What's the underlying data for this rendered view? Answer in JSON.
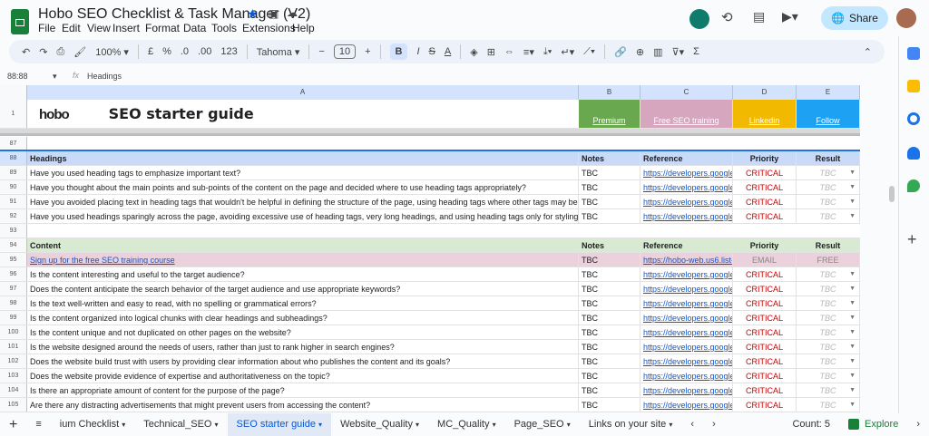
{
  "app": {
    "title": "Hobo SEO Checklist & Task Manager (V2)",
    "menu": [
      "File",
      "Edit",
      "View",
      "Insert",
      "Format",
      "Data",
      "Tools",
      "Extensions",
      "Help"
    ],
    "share_label": "Share"
  },
  "toolbar": {
    "zoom": "100%",
    "currency": "£",
    "percent": "%",
    "dec_less": ".0",
    "dec_more": ".00",
    "format_123": "123",
    "font": "Tahoma",
    "font_size": "10",
    "bold": "B",
    "italic": "I",
    "strike": "S",
    "text_color": "A"
  },
  "formula_bar": {
    "cell_ref": "88:88",
    "fx": "fx",
    "content": "Headings"
  },
  "columns": [
    "A",
    "B",
    "C",
    "D",
    "E"
  ],
  "header_row": {
    "brand": "hobo",
    "title": "SEO starter guide",
    "links": [
      {
        "label": "Premium",
        "color": "#6aa84f"
      },
      {
        "label": "Free SEO training",
        "color": "#d5a6bd"
      },
      {
        "label": "Linkedin",
        "color": "#f1b900"
      },
      {
        "label": "Follow",
        "color": "#1da1f2"
      }
    ]
  },
  "rows": [
    {
      "num": "87",
      "type": "blank"
    },
    {
      "num": "88",
      "type": "header",
      "a": "Headings",
      "b": "Notes",
      "c": "Reference",
      "d": "Priority",
      "e": "Result"
    },
    {
      "num": "89",
      "a": "Have you used heading tags to emphasize important text?",
      "b": "TBC",
      "c": "https://developers.google",
      "d": "CRITICAL",
      "e": "TBC"
    },
    {
      "num": "90",
      "a": "Have you thought about the main points and sub-points of the content on the page and decided where to use heading tags appropriately?",
      "b": "TBC",
      "c": "https://developers.google",
      "d": "CRITICAL",
      "e": "TBC"
    },
    {
      "num": "91",
      "a": "Have you avoided placing text in heading tags that wouldn't be helpful in defining the structure of the page, using heading tags where other tags may be",
      "b": "TBC",
      "c": "https://developers.google",
      "d": "CRITICAL",
      "e": "TBC"
    },
    {
      "num": "92",
      "a": "Have you used headings sparingly across the page, avoiding excessive use of heading tags, very long headings, and using heading tags only for styling te",
      "b": "TBC",
      "c": "https://developers.google",
      "d": "CRITICAL",
      "e": "TBC"
    },
    {
      "num": "93",
      "type": "blank"
    },
    {
      "num": "94",
      "type": "section",
      "a": "Content",
      "b": "Notes",
      "c": "Reference",
      "d": "Priority",
      "e": "Result"
    },
    {
      "num": "95",
      "type": "promo",
      "a": "Sign up for the free SEO training course",
      "b": "TBC",
      "c": "https://hobo-web.us6.list-",
      "d": "EMAIL",
      "e": "FREE"
    },
    {
      "num": "96",
      "a": "Is the content interesting and useful to the target audience?",
      "b": "TBC",
      "c": "https://developers.google",
      "d": "CRITICAL",
      "e": "TBC"
    },
    {
      "num": "97",
      "a": "Does the content anticipate the search behavior of the target audience and use appropriate keywords?",
      "b": "TBC",
      "c": "https://developers.google",
      "d": "CRITICAL",
      "e": "TBC"
    },
    {
      "num": "98",
      "a": "Is the text well-written and easy to read, with no spelling or grammatical errors?",
      "b": "TBC",
      "c": "https://developers.google",
      "d": "CRITICAL",
      "e": "TBC"
    },
    {
      "num": "99",
      "a": "Is the content organized into logical chunks with clear headings and subheadings?",
      "b": "TBC",
      "c": "https://developers.google",
      "d": "CRITICAL",
      "e": "TBC"
    },
    {
      "num": "100",
      "a": "Is the content unique and not duplicated on other pages on the website?",
      "b": "TBC",
      "c": "https://developers.google",
      "d": "CRITICAL",
      "e": "TBC"
    },
    {
      "num": "101",
      "a": "Is the website designed around the needs of users, rather than just to rank higher in search engines?",
      "b": "TBC",
      "c": "https://developers.google",
      "d": "CRITICAL",
      "e": "TBC"
    },
    {
      "num": "102",
      "a": "Does the website build trust with users by providing clear information about who publishes the content and its goals?",
      "b": "TBC",
      "c": "https://developers.google",
      "d": "CRITICAL",
      "e": "TBC"
    },
    {
      "num": "103",
      "a": "Does the website provide evidence of expertise and authoritativeness on the topic?",
      "b": "TBC",
      "c": "https://developers.google",
      "d": "CRITICAL",
      "e": "TBC"
    },
    {
      "num": "104",
      "a": "Is there an appropriate amount of content for the purpose of the page?",
      "b": "TBC",
      "c": "https://developers.google",
      "d": "CRITICAL",
      "e": "TBC"
    },
    {
      "num": "105",
      "a": "Are there any distracting advertisements that might prevent users from accessing the content?",
      "b": "TBC",
      "c": "https://developers.google",
      "d": "CRITICAL",
      "e": "TBC"
    }
  ],
  "sheet_tabs": [
    "ium Checklist",
    "Technical_SEO",
    "SEO starter guide",
    "Website_Quality",
    "MC_Quality",
    "Page_SEO",
    "Links on your site"
  ],
  "active_tab": "SEO starter guide",
  "status": {
    "count": "Count: 5",
    "explore": "Explore"
  }
}
